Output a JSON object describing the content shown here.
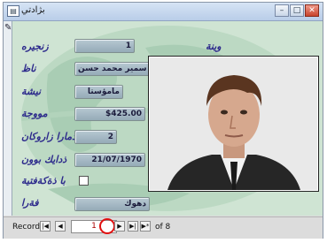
{
  "window": {
    "title": "بژادتي",
    "app_icon": "form-icon",
    "controls": {
      "min": "–",
      "max": "□",
      "close": "✕"
    }
  },
  "form": {
    "edit_icon": "pencil-icon",
    "fields": [
      {
        "label": "زنجيره",
        "value": "1",
        "extra_label": "وينة"
      },
      {
        "label": "ناظ",
        "value": "سمير محمد حسن"
      },
      {
        "label": "نيشة",
        "value": "مامؤستا"
      },
      {
        "label": "مووجة",
        "value": "$425.00"
      },
      {
        "label": "ذمارا زاروكان",
        "value": "2"
      },
      {
        "label": "ذدايك بوون",
        "value": "21/07/1970"
      },
      {
        "label": "با ذةكةفتية",
        "value": ""
      },
      {
        "label": "فةرا",
        "value": "دهوك"
      }
    ],
    "checkbox_checked": false
  },
  "navigation": {
    "label": "Record:",
    "first": "|◀",
    "prev": "◀",
    "current": "1",
    "next": "▶",
    "last": "▶|",
    "new": "▶*",
    "total": "of 8"
  },
  "colors": {
    "form_bg": "#cfe4d3",
    "label": "#2d2a8c",
    "highlight": "#e01010"
  }
}
